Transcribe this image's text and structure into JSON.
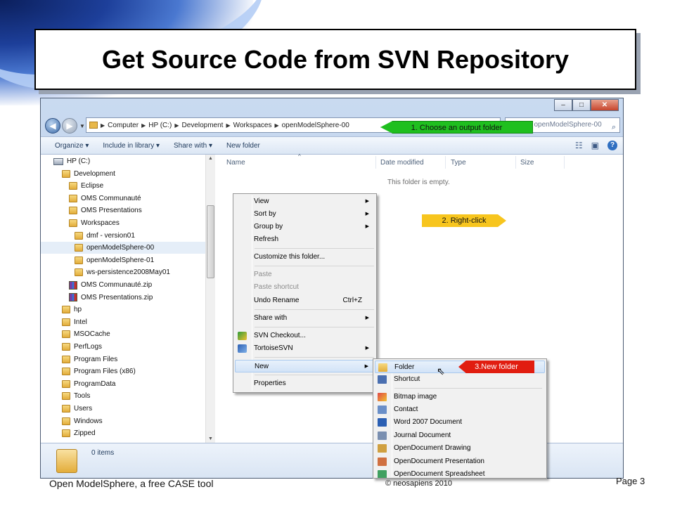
{
  "slide": {
    "title": "Get Source Code from SVN Repository",
    "footer_left": "Open ModelSphere, a free CASE tool",
    "footer_center": "© neosapiens 2010",
    "footer_right": "Page 3"
  },
  "window": {
    "controls": [
      "–",
      "□",
      "✕"
    ],
    "breadcrumbs": [
      "Computer",
      "HP (C:)",
      "Development",
      "Workspaces",
      "openModelSphere-00"
    ],
    "search_placeholder": "Search openModelSphere-00",
    "toolbar": [
      "Organize ▾",
      "Include in library ▾",
      "Share with ▾",
      "New folder"
    ],
    "columns": [
      "Name",
      "Date modified",
      "Type",
      "Size"
    ],
    "empty_message": "This folder is empty.",
    "status_count": "0 items"
  },
  "tree": [
    {
      "label": "HP (C:)",
      "icon": "drive-icon"
    },
    {
      "label": "Development",
      "icon": "folder-icon"
    },
    {
      "label": "Eclipse",
      "icon": "folder-icon"
    },
    {
      "label": "OMS Communauté",
      "icon": "folder-icon"
    },
    {
      "label": "OMS Presentations",
      "icon": "folder-icon"
    },
    {
      "label": "Workspaces",
      "icon": "folder-icon"
    },
    {
      "label": "dmf - version01",
      "icon": "folder-icon"
    },
    {
      "label": "openModelSphere-00",
      "icon": "folder-icon"
    },
    {
      "label": "openModelSphere-01",
      "icon": "folder-icon"
    },
    {
      "label": "ws-persistence2008May01",
      "icon": "folder-icon"
    },
    {
      "label": "OMS Communauté.zip",
      "icon": "zip-icon"
    },
    {
      "label": "OMS Presentations.zip",
      "icon": "zip-icon"
    },
    {
      "label": "hp",
      "icon": "folder-icon"
    },
    {
      "label": "Intel",
      "icon": "folder-icon"
    },
    {
      "label": "MSOCache",
      "icon": "folder-icon"
    },
    {
      "label": "PerfLogs",
      "icon": "folder-icon"
    },
    {
      "label": "Program Files",
      "icon": "folder-icon"
    },
    {
      "label": "Program Files (x86)",
      "icon": "folder-icon"
    },
    {
      "label": "ProgramData",
      "icon": "folder-icon"
    },
    {
      "label": "Tools",
      "icon": "folder-icon"
    },
    {
      "label": "Users",
      "icon": "folder-icon"
    },
    {
      "label": "Windows",
      "icon": "folder-icon"
    },
    {
      "label": "Zipped",
      "icon": "folder-icon"
    }
  ],
  "context_menu": [
    {
      "label": "View",
      "submenu": true
    },
    {
      "label": "Sort by",
      "submenu": true
    },
    {
      "label": "Group by",
      "submenu": true
    },
    {
      "label": "Refresh"
    },
    {
      "label": "Customize this folder..."
    },
    {
      "label": "Paste",
      "disabled": true
    },
    {
      "label": "Paste shortcut",
      "disabled": true
    },
    {
      "label": "Undo Rename",
      "shortcut": "Ctrl+Z"
    },
    {
      "label": "Share with",
      "submenu": true
    },
    {
      "label": "SVN Checkout...",
      "icon": "svn-checkout-icon"
    },
    {
      "label": "TortoiseSVN",
      "submenu": true,
      "icon": "tortoisesvn-icon"
    },
    {
      "label": "New",
      "submenu": true,
      "highlighted": true
    },
    {
      "label": "Properties"
    }
  ],
  "new_submenu": [
    {
      "label": "Folder",
      "highlighted": true
    },
    {
      "label": "Shortcut"
    },
    {
      "label": "Bitmap image"
    },
    {
      "label": "Contact"
    },
    {
      "label": "Word 2007 Document"
    },
    {
      "label": "Journal Document"
    },
    {
      "label": "OpenDocument Drawing"
    },
    {
      "label": "OpenDocument Presentation"
    },
    {
      "label": "OpenDocument Spreadsheet"
    }
  ],
  "callouts": {
    "step1": "1. Choose an output folder",
    "step2": "2. Right-click",
    "step3": "3.New folder"
  },
  "colors": {
    "callout1": "#1fbf1f",
    "callout2": "#f7c51e",
    "callout3": "#e11d10"
  }
}
